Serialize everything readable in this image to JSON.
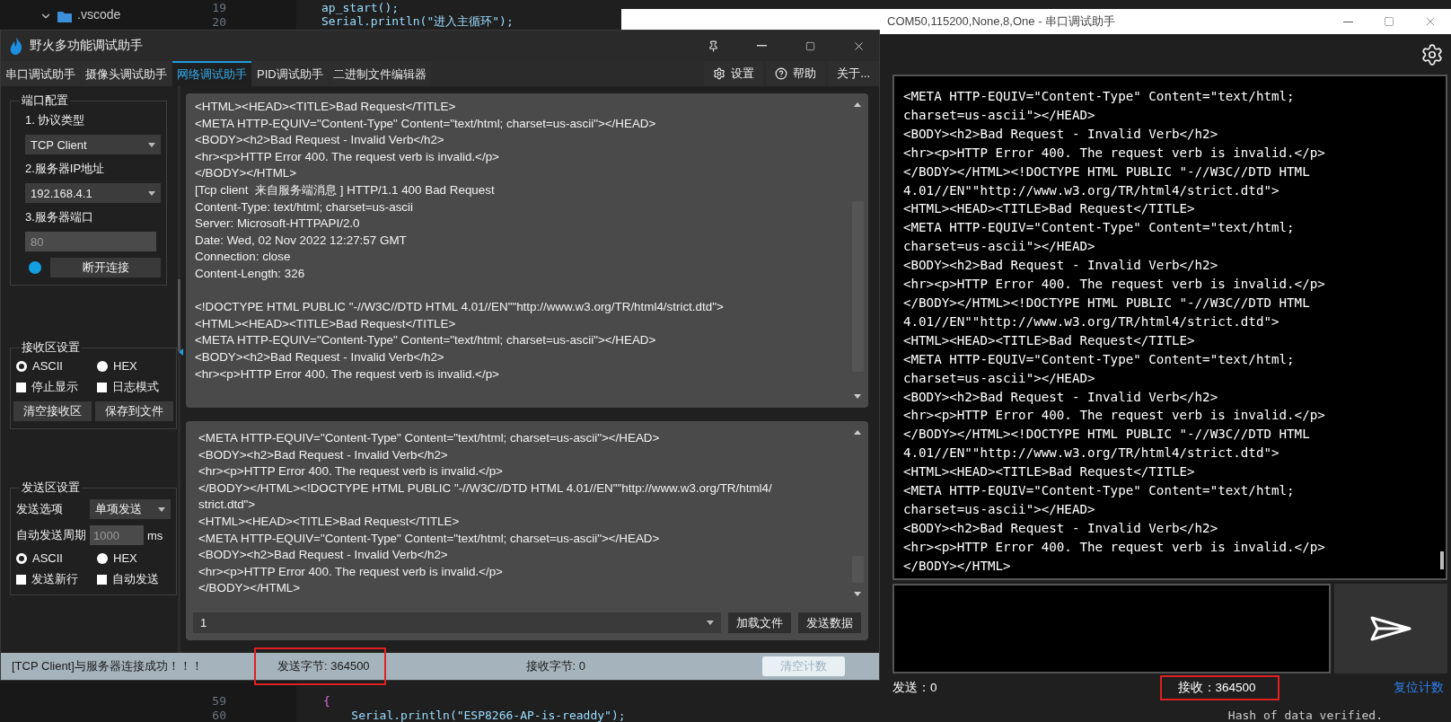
{
  "editor": {
    "explorer_item": ".vscode",
    "top_lines": [
      {
        "number": "19",
        "code": "ap_start();"
      },
      {
        "number": "20",
        "code": "Serial.println(\"进入主循环\");"
      }
    ],
    "bottom_lines": [
      {
        "number": "59",
        "code": "{"
      },
      {
        "number": "60",
        "code": "    Serial.println(\"ESP8266-AP-is-readdy\");"
      }
    ],
    "terminal_text": "Hash of data verified."
  },
  "serial_window": {
    "title": "COM50,115200,None,8,One - 串口调试助手",
    "receive_lines": [
      "<META HTTP-EQUIV=\"Content-Type\" Content=\"text/html;",
      "charset=us-ascii\"></HEAD>",
      "<BODY><h2>Bad Request - Invalid Verb</h2>",
      "<hr><p>HTTP Error 400. The request verb is invalid.</p>",
      "</BODY></HTML><!DOCTYPE HTML PUBLIC \"-//W3C//DTD HTML",
      "4.01//EN\"\"http://www.w3.org/TR/html4/strict.dtd\">",
      "<HTML><HEAD><TITLE>Bad Request</TITLE>",
      "<META HTTP-EQUIV=\"Content-Type\" Content=\"text/html;",
      "charset=us-ascii\"></HEAD>",
      "<BODY><h2>Bad Request - Invalid Verb</h2>",
      "<hr><p>HTTP Error 400. The request verb is invalid.</p>",
      "</BODY></HTML><!DOCTYPE HTML PUBLIC \"-//W3C//DTD HTML",
      "4.01//EN\"\"http://www.w3.org/TR/html4/strict.dtd\">",
      "<HTML><HEAD><TITLE>Bad Request</TITLE>",
      "<META HTTP-EQUIV=\"Content-Type\" Content=\"text/html;",
      "charset=us-ascii\"></HEAD>",
      "<BODY><h2>Bad Request - Invalid Verb</h2>",
      "<hr><p>HTTP Error 400. The request verb is invalid.</p>",
      "</BODY></HTML><!DOCTYPE HTML PUBLIC \"-//W3C//DTD HTML",
      "4.01//EN\"\"http://www.w3.org/TR/html4/strict.dtd\">",
      "<HTML><HEAD><TITLE>Bad Request</TITLE>",
      "<META HTTP-EQUIV=\"Content-Type\" Content=\"text/html;",
      "charset=us-ascii\"></HEAD>",
      "<BODY><h2>Bad Request - Invalid Verb</h2>",
      "<hr><p>HTTP Error 400. The request verb is invalid.</p>",
      "</BODY></HTML>"
    ],
    "sent": {
      "text": "发送：0",
      "highlighted": false
    },
    "received": {
      "text": "接收：364500",
      "highlighted": true
    },
    "reset_link": "复位计数"
  },
  "tool_window": {
    "title": "野火多功能调试助手",
    "tabs": [
      {
        "label": "串口调试助手",
        "selected": false
      },
      {
        "label": "摄像头调试助手",
        "selected": false
      },
      {
        "label": "网络调试助手",
        "selected": true
      },
      {
        "label": "PID调试助手",
        "selected": false
      },
      {
        "label": "二进制文件编辑器",
        "selected": false
      }
    ],
    "actions": [
      {
        "label": "设置",
        "kind": "settings"
      },
      {
        "label": "帮助",
        "kind": "help"
      },
      {
        "label": "关于...",
        "kind": "plain"
      }
    ],
    "port_config": {
      "title": "端口配置",
      "protocol_label": "1. 协议类型",
      "protocol": "TCP Client",
      "ip_label": "2.服务器IP地址",
      "ip": "192.168.4.1",
      "port_label": "3.服务器端口",
      "port": "80",
      "connected": true,
      "connect_button": "断开连接"
    },
    "receive_settings": {
      "title": "接收区设置",
      "format": [
        {
          "label": "ASCII",
          "selected": true
        },
        {
          "label": "HEX",
          "selected": false
        }
      ],
      "options": [
        {
          "label": "停止显示",
          "checked": false
        },
        {
          "label": "日志模式",
          "checked": false
        }
      ],
      "buttons": [
        "清空接收区",
        "保存到文件"
      ]
    },
    "send_settings": {
      "title": "发送区设置",
      "option_label": "发送选项",
      "option": "单项发送",
      "period_label": "自动发送周期",
      "period": "1000",
      "period_unit": "ms",
      "format": [
        {
          "label": "ASCII",
          "selected": true
        },
        {
          "label": "HEX",
          "selected": false
        }
      ],
      "options": [
        {
          "label": "发送新行",
          "checked": false
        },
        {
          "label": "自动发送",
          "checked": false
        }
      ]
    },
    "receive_blocks": [
      [
        "<HTML><HEAD><TITLE>Bad Request</TITLE>",
        "<META HTTP-EQUIV=\"Content-Type\" Content=\"text/html; charset=us-ascii\"></HEAD>",
        "<BODY><h2>Bad Request - Invalid Verb</h2>",
        "<hr><p>HTTP Error 400. The request verb is invalid.</p>",
        "</BODY></HTML>",
        "[Tcp client  来自服务端消息 ] HTTP/1.1 400 Bad Request",
        "Content-Type: text/html; charset=us-ascii",
        "Server: Microsoft-HTTPAPI/2.0",
        "Date: Wed, 02 Nov 2022 12:27:57 GMT",
        "Connection: close",
        "Content-Length: 326"
      ],
      [
        "<!DOCTYPE HTML PUBLIC \"-//W3C//DTD HTML 4.01//EN\"\"http://www.w3.org/TR/html4/strict.dtd\">",
        "<HTML><HEAD><TITLE>Bad Request</TITLE>",
        "<META HTTP-EQUIV=\"Content-Type\" Content=\"text/html; charset=us-ascii\"></HEAD>",
        "<BODY><h2>Bad Request - Invalid Verb</h2>",
        "<hr><p>HTTP Error 400. The request verb is invalid.</p>"
      ]
    ],
    "send_lines": [
      "<META HTTP-EQUIV=\"Content-Type\" Content=\"text/html; charset=us-ascii\"></HEAD>",
      "<BODY><h2>Bad Request - Invalid Verb</h2>",
      "<hr><p>HTTP Error 400. The request verb is invalid.</p>",
      "</BODY></HTML><!DOCTYPE HTML PUBLIC \"-//W3C//DTD HTML 4.01//EN\"\"http://www.w3.org/TR/html4/",
      "strict.dtd\">",
      "<HTML><HEAD><TITLE>Bad Request</TITLE>",
      "<META HTTP-EQUIV=\"Content-Type\" Content=\"text/html; charset=us-ascii\"></HEAD>",
      "<BODY><h2>Bad Request - Invalid Verb</h2>",
      "<hr><p>HTTP Error 400. The request verb is invalid.</p>",
      "</BODY></HTML>"
    ],
    "send_input": "1",
    "send_buttons": [
      "加载文件",
      "发送数据"
    ],
    "status": {
      "message": "[TCP Client]与服务器连接成功！！！",
      "sent": {
        "text": "发送字节: 364500",
        "highlighted": true
      },
      "received": {
        "text": "接收字节: 0",
        "highlighted": false
      },
      "clear_button": "清空计数"
    }
  }
}
